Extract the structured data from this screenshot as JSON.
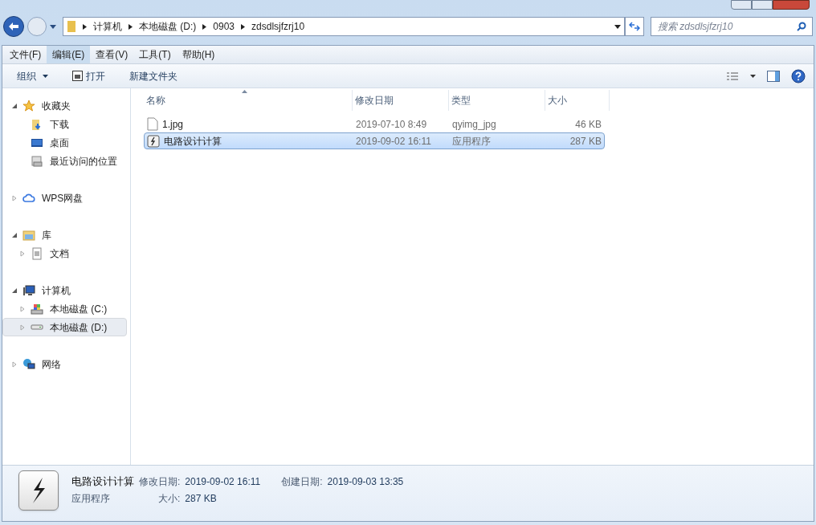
{
  "breadcrumb": [
    "计算机",
    "本地磁盘 (D:)",
    "0903",
    "zdsdlsjfzrj10"
  ],
  "search": {
    "placeholder": "搜索 zdsdlsjfzrj10"
  },
  "menu": [
    {
      "label": "文件(F)",
      "selected": false
    },
    {
      "label": "编辑(E)",
      "selected": true
    },
    {
      "label": "查看(V)",
      "selected": false
    },
    {
      "label": "工具(T)",
      "selected": false
    },
    {
      "label": "帮助(H)",
      "selected": false
    }
  ],
  "toolbar": [
    {
      "kind": "dropdown",
      "label": "组织"
    },
    {
      "kind": "open",
      "label": "打开"
    },
    {
      "kind": "plain",
      "label": "新建文件夹"
    }
  ],
  "sidebar": [
    {
      "label": "收藏夹",
      "kind": "favorites",
      "expanded": true,
      "selected": false,
      "children": [
        {
          "label": "下载",
          "kind": "downloads",
          "selected": false
        },
        {
          "label": "桌面",
          "kind": "desktop",
          "selected": false
        },
        {
          "label": "最近访问的位置",
          "kind": "recent",
          "selected": false
        }
      ]
    },
    {
      "label": "WPS网盘",
      "kind": "cloud",
      "expanded": false,
      "selected": false
    },
    {
      "label": "库",
      "kind": "library",
      "expanded": true,
      "selected": false,
      "children": [
        {
          "label": "文档",
          "kind": "documents",
          "expanded": false,
          "selected": false
        }
      ]
    },
    {
      "label": "计算机",
      "kind": "computer",
      "expanded": true,
      "selected": false,
      "children": [
        {
          "label": "本地磁盘 (C:)",
          "kind": "sysdrive",
          "expanded": false,
          "selected": false
        },
        {
          "label": "本地磁盘 (D:)",
          "kind": "drive",
          "expanded": false,
          "selected": true
        }
      ]
    },
    {
      "label": "网络",
      "kind": "network",
      "expanded": false,
      "selected": false
    }
  ],
  "table": {
    "columns": [
      "名称",
      "修改日期",
      "类型",
      "大小"
    ],
    "rows": [
      {
        "kind": "file",
        "name": "1.jpg",
        "modified": "2019-07-10 8:49",
        "type": "qyimg_jpg",
        "size": "46 KB",
        "selected": false
      },
      {
        "kind": "app",
        "name": "电路设计计算",
        "modified": "2019-09-02 16:11",
        "type": "应用程序",
        "size": "287 KB",
        "selected": true
      }
    ]
  },
  "details": {
    "name": "电路设计计算",
    "type": "应用程序",
    "modified_label": "修改日期:",
    "modified": "2019-09-02 16:11",
    "created_label": "创建日期:",
    "created": "2019-09-03 13:35",
    "size_label": "大小:",
    "size": "287 KB"
  }
}
